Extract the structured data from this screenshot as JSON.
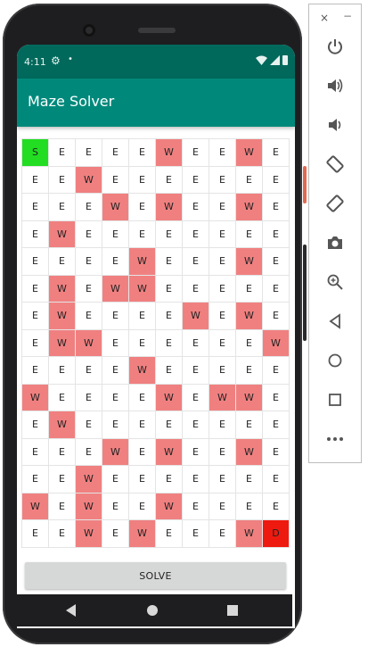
{
  "status_bar": {
    "time": "4:11",
    "gear_icon": "⚙",
    "dot_icon": "•"
  },
  "app": {
    "title": "Maze Solver"
  },
  "maze": {
    "rows": [
      [
        "S",
        "E",
        "E",
        "E",
        "E",
        "W",
        "E",
        "E",
        "W",
        "E"
      ],
      [
        "E",
        "E",
        "W",
        "E",
        "E",
        "E",
        "E",
        "E",
        "E",
        "E"
      ],
      [
        "E",
        "E",
        "E",
        "W",
        "E",
        "W",
        "E",
        "E",
        "W",
        "E"
      ],
      [
        "E",
        "W",
        "E",
        "E",
        "E",
        "E",
        "E",
        "E",
        "E",
        "E"
      ],
      [
        "E",
        "E",
        "E",
        "E",
        "W",
        "E",
        "E",
        "E",
        "W",
        "E"
      ],
      [
        "E",
        "W",
        "E",
        "W",
        "W",
        "E",
        "E",
        "E",
        "E",
        "E"
      ],
      [
        "E",
        "W",
        "E",
        "E",
        "E",
        "E",
        "W",
        "E",
        "W",
        "E"
      ],
      [
        "E",
        "W",
        "W",
        "E",
        "E",
        "E",
        "E",
        "E",
        "E",
        "W"
      ],
      [
        "E",
        "E",
        "E",
        "E",
        "W",
        "E",
        "E",
        "E",
        "E",
        "E"
      ],
      [
        "W",
        "E",
        "E",
        "E",
        "E",
        "W",
        "E",
        "W",
        "W",
        "E"
      ],
      [
        "E",
        "W",
        "E",
        "E",
        "E",
        "E",
        "E",
        "E",
        "E",
        "E"
      ],
      [
        "E",
        "E",
        "E",
        "W",
        "E",
        "W",
        "E",
        "E",
        "W",
        "E"
      ],
      [
        "E",
        "E",
        "W",
        "E",
        "E",
        "E",
        "E",
        "E",
        "E",
        "E"
      ],
      [
        "W",
        "E",
        "W",
        "E",
        "E",
        "W",
        "E",
        "E",
        "E",
        "E"
      ],
      [
        "E",
        "E",
        "W",
        "E",
        "W",
        "E",
        "E",
        "E",
        "W",
        "D"
      ]
    ],
    "colors": {
      "start": "#22dd22",
      "wall": "#f08080",
      "destination": "#ee1a10",
      "empty": "#ffffff"
    }
  },
  "solve_button": {
    "label": "SOLVE"
  },
  "theme": {
    "status_bar": "#00695c",
    "app_bar": "#00897b"
  },
  "toolbar": {
    "close": "×",
    "minimize": "−",
    "icons": [
      "power-icon",
      "volume-up-icon",
      "volume-down-icon",
      "rotate-left-icon",
      "rotate-right-icon",
      "camera-icon",
      "zoom-icon",
      "back-icon",
      "home-icon",
      "overview-icon",
      "more-icon"
    ]
  }
}
